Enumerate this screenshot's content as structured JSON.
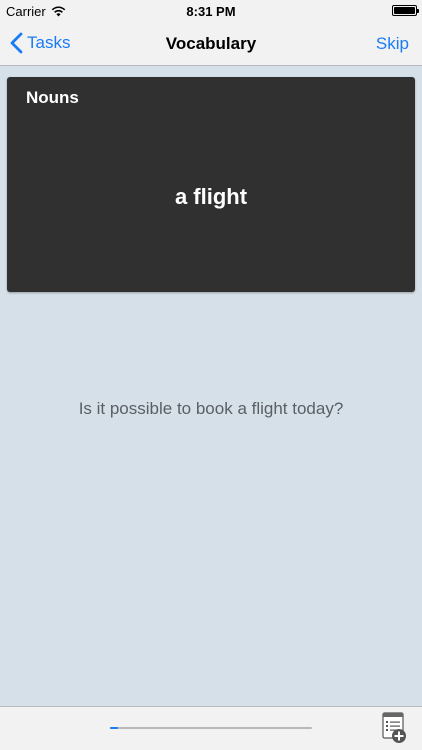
{
  "status_bar": {
    "carrier": "Carrier",
    "time": "8:31 PM",
    "icons": [
      "wifi-icon",
      "battery-icon"
    ]
  },
  "nav": {
    "back_label": "Tasks",
    "title": "Vocabulary",
    "skip_label": "Skip",
    "back_icon": "chevron-left-icon"
  },
  "card": {
    "category": "Nouns",
    "word": "a flight"
  },
  "sentence": "Is it possible to book a flight today?",
  "toolbar": {
    "progress": 0.04,
    "add_icon": "add-to-list-icon"
  },
  "colors": {
    "accent": "#1a7cf4",
    "background": "#d6e0e8",
    "card": "#303030",
    "bars": "#f2f2f3"
  }
}
